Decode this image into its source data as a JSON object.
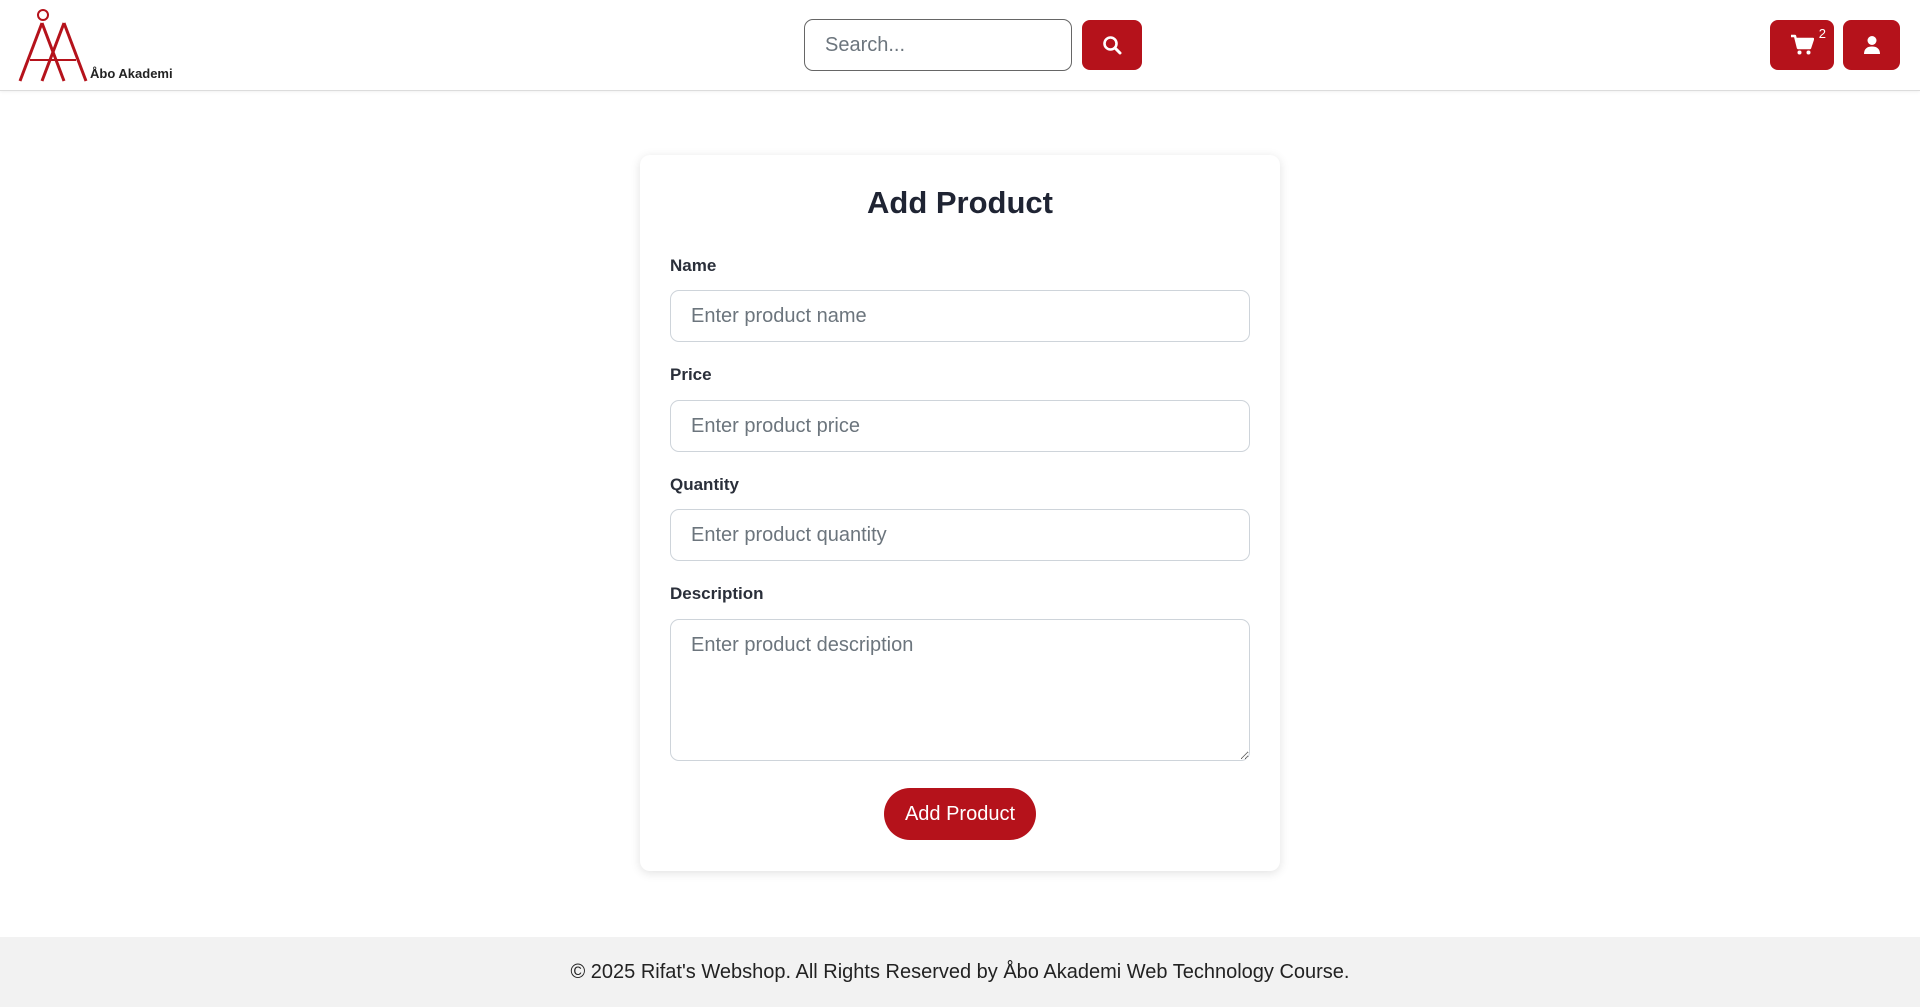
{
  "header": {
    "logo_text": "Åbo Akademi",
    "search": {
      "placeholder": "Search..."
    },
    "cart": {
      "count": "2"
    }
  },
  "form": {
    "title": "Add Product",
    "fields": [
      {
        "label": "Name",
        "placeholder": "Enter product name"
      },
      {
        "label": "Price",
        "placeholder": "Enter product price"
      },
      {
        "label": "Quantity",
        "placeholder": "Enter product quantity"
      },
      {
        "label": "Description",
        "placeholder": "Enter product description"
      }
    ],
    "submit_label": "Add Product"
  },
  "footer": {
    "text": "© 2025 Rifat's Webshop. All Rights Reserved by Åbo Akademi Web Technology Course."
  },
  "colors": {
    "accent": "#b5121b",
    "footer_bg": "#f2f2f2"
  },
  "icons": {
    "search": "search-icon",
    "cart": "cart-icon",
    "user": "user-icon",
    "logo": "abo-akademi-logo"
  }
}
